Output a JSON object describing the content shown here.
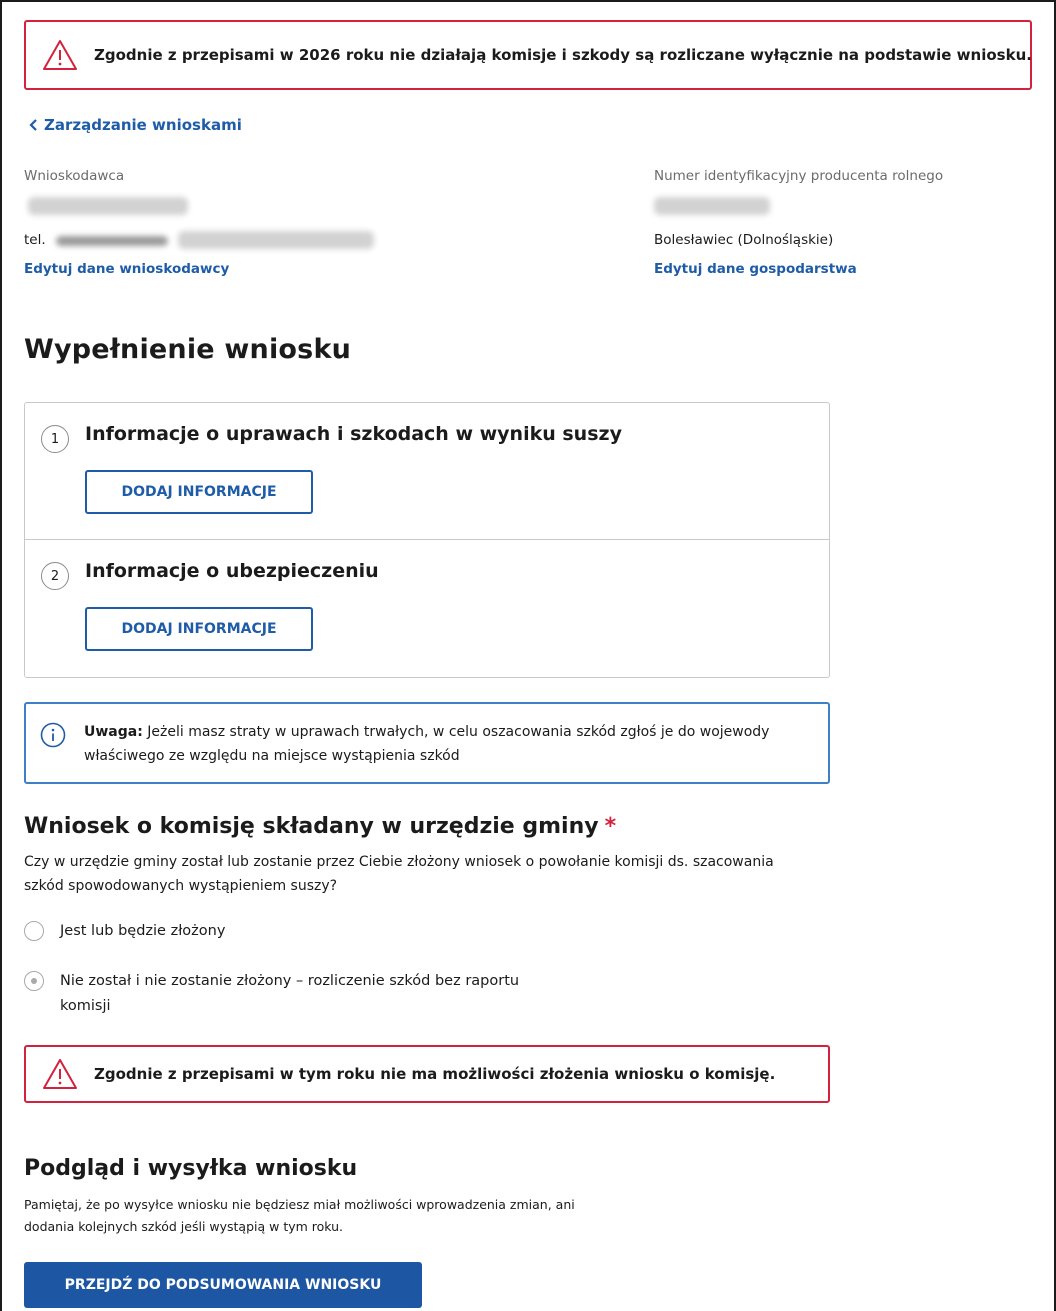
{
  "alerts": {
    "top": "Zgodnie z przepisami w 2026 roku nie działają komisje i szkody są rozliczane wyłącznie na podstawie wniosku.",
    "bottom": "Zgodnie z przepisami w tym roku nie ma możliwości złożenia wniosku o komisję."
  },
  "nav": {
    "back_label": "Zarządzanie wnioskami"
  },
  "applicant": {
    "label": "Wnioskodawca",
    "phone_prefix": "tel.",
    "edit_link": "Edytuj dane wnioskodawcy"
  },
  "farm": {
    "label": "Numer identyfikacyjny producenta rolnego",
    "location": "Bolesławiec (Dolnośląskie)",
    "edit_link": "Edytuj dane gospodarstwa"
  },
  "form": {
    "title": "Wypełnienie wniosku",
    "steps": [
      {
        "number": "1",
        "title": "Informacje o uprawach i szkodach w wyniku suszy",
        "button": "DODAJ INFORMACJE"
      },
      {
        "number": "2",
        "title": "Informacje o ubezpieczeniu",
        "button": "DODAJ INFORMACJE"
      }
    ]
  },
  "notice": {
    "bold": "Uwaga:",
    "text": " Jeżeli masz straty w uprawach trwałych, w celu oszacowania szkód zgłoś je do wojewody właściwego ze względu na miejsce wystąpienia szkód"
  },
  "commission": {
    "title": "Wniosek o komisję składany w urzędzie gminy",
    "required_mark": "*",
    "question": "Czy w urzędzie gminy został lub zostanie przez Ciebie złożony wniosek o powołanie komisji ds. szacowania szkód spowodowanych wystąpieniem suszy?",
    "options": [
      {
        "label": "Jest lub będzie złożony",
        "selected": false
      },
      {
        "label": "Nie został i nie zostanie złożony – rozliczenie szkód bez raportu komisji",
        "selected": true
      }
    ]
  },
  "preview": {
    "title": "Podgląd i wysyłka wniosku",
    "note": "Pamiętaj, że po wysyłce wniosku nie będziesz miał możliwości wprowadzenia zmian, ani dodania kolejnych szkód jeśli wystąpią w tym roku.",
    "button": "PRZEJDŹ DO PODSUMOWANIA WNIOSKU"
  },
  "colors": {
    "alert_border": "#d4213d",
    "link": "#1f5ca8",
    "info_border": "#3f7fc8",
    "primary_button": "#1d57a3"
  }
}
